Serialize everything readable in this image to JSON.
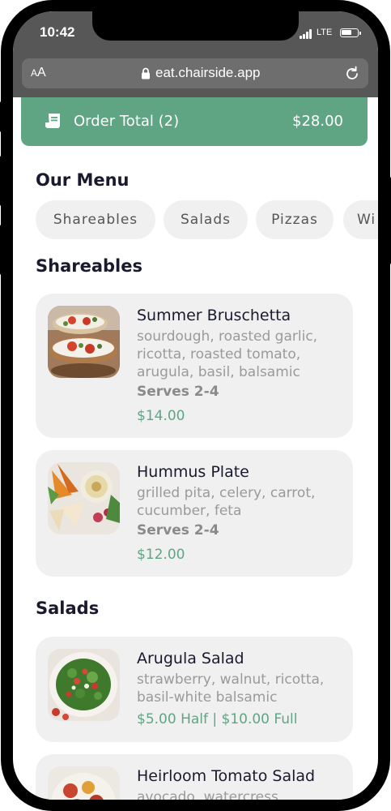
{
  "status_bar": {
    "time": "10:42",
    "network": "LTE"
  },
  "browser": {
    "text_size_small": "A",
    "text_size_large": "A",
    "url": "eat.chairside.app"
  },
  "order_bar": {
    "label": "Order Total (2)",
    "total": "$28.00"
  },
  "menu": {
    "title": "Our Menu",
    "categories": [
      "Shareables",
      "Salads",
      "Pizzas",
      "Wi"
    ]
  },
  "sections": [
    {
      "title": "Shareables",
      "items": [
        {
          "name": "Summer Bruschetta",
          "description": "sourdough, roasted garlic, ricotta, roasted tomato, arugula, basil, balsamic",
          "serves": "Serves 2-4",
          "price": "$14.00"
        },
        {
          "name": "Hummus Plate",
          "description": "grilled pita, celery, carrot, cucumber, feta",
          "serves": "Serves 2-4",
          "price": "$12.00"
        }
      ]
    },
    {
      "title": "Salads",
      "items": [
        {
          "name": "Arugula Salad",
          "description": "strawberry, walnut, ricotta, basil-white balsamic",
          "price": "$5.00 Half | $10.00 Full"
        },
        {
          "name": "Heirloom Tomato Salad",
          "description": "avocado, watercress"
        }
      ]
    }
  ],
  "colors": {
    "accent": "#5fa583",
    "card_bg": "#f0f0f0",
    "heading": "#1a1a2e",
    "muted_text": "#9a9a9a"
  },
  "icons": [
    "lock-icon",
    "reload-icon",
    "receipt-icon",
    "signal-icon",
    "battery-icon"
  ]
}
